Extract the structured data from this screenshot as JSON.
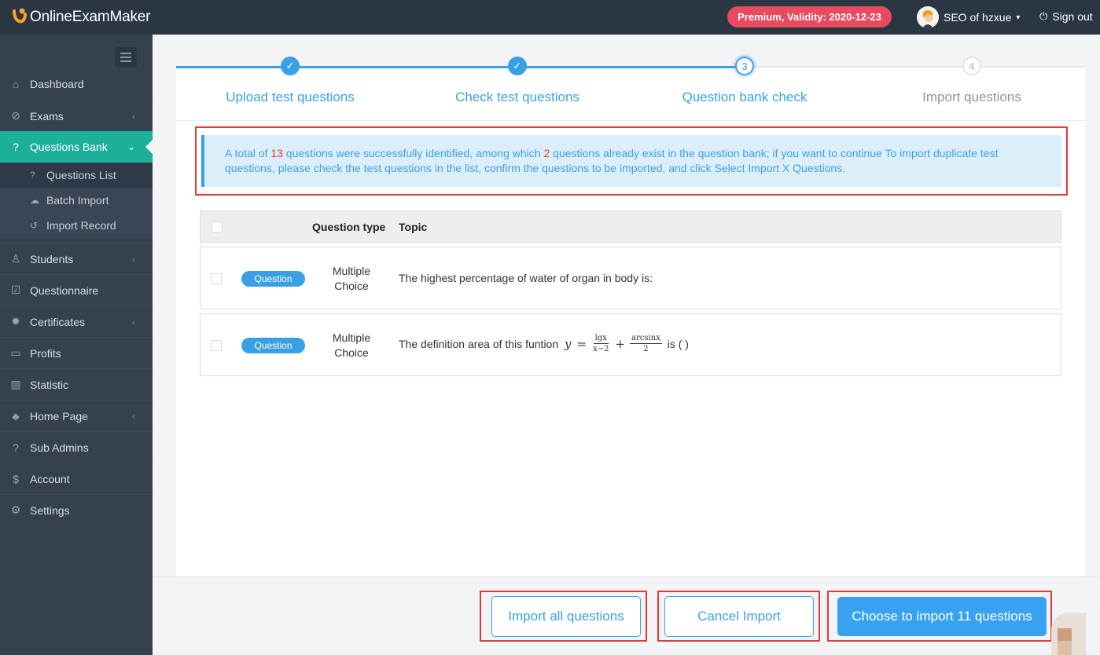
{
  "app": {
    "logo_text": "OnlineExamMaker"
  },
  "header": {
    "premium_badge": "Premium, Validity: 2020-12-23",
    "user_name": "SEO of hzxue",
    "signout_label": "Sign out"
  },
  "sidebar": {
    "items": [
      {
        "label": "Dashboard",
        "icon": "home-icon"
      },
      {
        "label": "Exams",
        "icon": "check-circle-icon"
      },
      {
        "label": "Questions Bank",
        "icon": "question-circle-icon"
      },
      {
        "label": "Students",
        "icon": "users-icon"
      },
      {
        "label": "Questionnaire",
        "icon": "checkbox-icon"
      },
      {
        "label": "Certificates",
        "icon": "gear-badge-icon"
      },
      {
        "label": "Profits",
        "icon": "credit-card-icon"
      },
      {
        "label": "Statistic",
        "icon": "bar-chart-icon"
      },
      {
        "label": "Home Page",
        "icon": "tree-icon"
      },
      {
        "label": "Sub Admins",
        "icon": "question-circle-icon"
      },
      {
        "label": "Account",
        "icon": "dollar-icon"
      },
      {
        "label": "Settings",
        "icon": "gear-icon"
      }
    ],
    "sub_items": [
      {
        "label": "Questions List"
      },
      {
        "label": "Batch Import"
      },
      {
        "label": "Import Record"
      }
    ]
  },
  "steps": [
    {
      "label": "Upload test questions",
      "state": "done"
    },
    {
      "label": "Check test questions",
      "state": "done"
    },
    {
      "label": "Question bank check",
      "state": "current",
      "number": "3"
    },
    {
      "label": "Import questions",
      "state": "todo",
      "number": "4"
    }
  ],
  "alert": {
    "part1": "A total of ",
    "total": "13",
    "part2": " questions were successfully identified, among which ",
    "dupes": "2",
    "part3": " questions already exist in the question bank; if you want to continue To import duplicate test questions, please check the test questions in the list, confirm the questions to be imported, and click Select Import X Questions."
  },
  "table": {
    "headers": {
      "type": "Question type",
      "topic": "Topic"
    },
    "rows": [
      {
        "badge": "Question",
        "type_line1": "Multiple",
        "type_line2": "Choice",
        "topic": "The highest percentage of water of organ in body is:"
      },
      {
        "badge": "Question",
        "type_line1": "Multiple",
        "type_line2": "Choice",
        "topic_pre": "The definition area of this funtion ",
        "math_y": "y",
        "math_eq": "=",
        "frac1_num": "lgx",
        "frac1_den": "x−2",
        "math_plus": "+",
        "frac2_num": "arcsinx",
        "frac2_den": "2",
        "topic_post": " is ( )"
      }
    ]
  },
  "footer": {
    "import_all": "Import all questions",
    "cancel": "Cancel Import",
    "choose": "Choose to import 11 questions"
  },
  "colors": {
    "accent": "#3aa0e6",
    "sidebar_active": "#1caf9a",
    "premium": "#e84a5f",
    "highlight_box": "#e0393e"
  }
}
